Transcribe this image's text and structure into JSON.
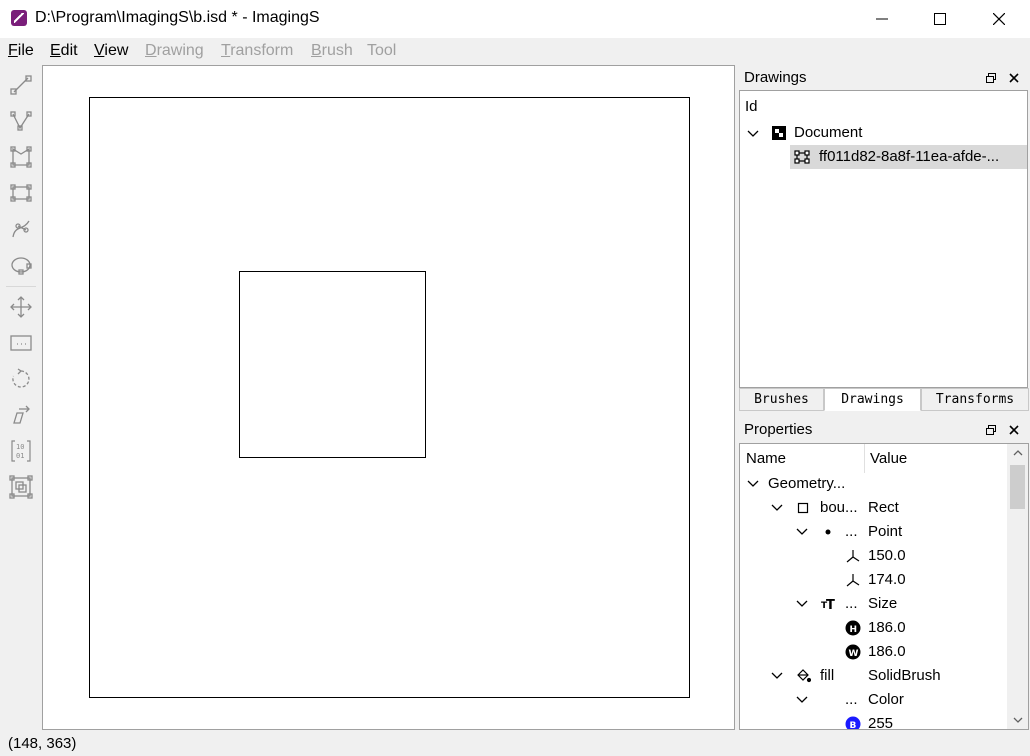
{
  "window": {
    "title": "D:\\Program\\ImagingS\\b.isd * - ImagingS",
    "app_icon": "pen-icon",
    "buttons": [
      "minimize-icon",
      "maximize-icon",
      "close-icon"
    ]
  },
  "menu": [
    {
      "label": "File",
      "mnemonic": "F",
      "rest": "ile",
      "enabled": true
    },
    {
      "label": "Edit",
      "mnemonic": "E",
      "rest": "dit",
      "enabled": true
    },
    {
      "label": "View",
      "mnemonic": "V",
      "rest": "iew",
      "enabled": true
    },
    {
      "label": "Drawing",
      "mnemonic": "D",
      "rest": "rawing",
      "enabled": false
    },
    {
      "label": "Transform",
      "mnemonic": "T",
      "rest": "ransform",
      "enabled": false
    },
    {
      "label": "Brush",
      "mnemonic": "B",
      "rest": "rush",
      "enabled": false
    },
    {
      "label": "Tool",
      "mnemonic": "",
      "rest": "Tool",
      "enabled": false
    }
  ],
  "toolbar": {
    "drawing_tools": [
      "line-tool-icon",
      "polyline-tool-icon",
      "polygon-tool-icon",
      "rectangle-tool-icon",
      "curve-tool-icon",
      "ellipse-tool-icon"
    ],
    "transform_tools": [
      "move-tool-icon",
      "scale-tool-icon",
      "rotate-tool-icon",
      "skew-tool-icon",
      "matrix-tool-icon",
      "clip-tool-icon"
    ]
  },
  "drawings_panel": {
    "title": "Drawings",
    "header": "Id",
    "root": {
      "label": "Document",
      "icon": "document-icon",
      "expanded": true
    },
    "children": [
      {
        "label": "ff011d82-8a8f-11ea-afde-...",
        "icon": "rectangle-icon",
        "selected": true
      }
    ]
  },
  "tabs": [
    {
      "label": "Brushes",
      "active": false
    },
    {
      "label": "Drawings",
      "active": true
    },
    {
      "label": "Transforms",
      "active": false
    }
  ],
  "properties_panel": {
    "title": "Properties",
    "columns": [
      "Name",
      "Value"
    ],
    "rows": [
      {
        "name": "Geometry...",
        "value": "",
        "expanded": true,
        "icon": ""
      },
      {
        "name": "bou...",
        "value": "Rect",
        "expanded": true,
        "icon": "rect-icon"
      },
      {
        "name": "...",
        "value": "Point",
        "expanded": true,
        "icon": "point-icon"
      },
      {
        "name": "",
        "value": "150.0",
        "expanded": null,
        "icon": "axis-x-icon"
      },
      {
        "name": "",
        "value": "174.0",
        "expanded": null,
        "icon": "axis-y-icon"
      },
      {
        "name": "...",
        "value": "Size",
        "expanded": true,
        "icon": "text-size-icon"
      },
      {
        "name": "",
        "value": "186.0",
        "expanded": null,
        "icon": "height-icon",
        "badge": "H"
      },
      {
        "name": "",
        "value": "186.0",
        "expanded": null,
        "icon": "width-icon",
        "badge": "W"
      },
      {
        "name": "fill",
        "value": "SolidBrush",
        "expanded": true,
        "icon": "fill-icon"
      },
      {
        "name": "...",
        "value": "Color",
        "expanded": true,
        "icon": ""
      },
      {
        "name": "",
        "value": "255",
        "expanded": null,
        "icon": "blue-channel-icon",
        "badge": "B"
      }
    ]
  },
  "status": {
    "cursor": "(148, 363)"
  },
  "colors": {
    "accent": "#7a1e7a",
    "badge_blue": "#1a1aff",
    "selection": "#d9d9d9"
  }
}
